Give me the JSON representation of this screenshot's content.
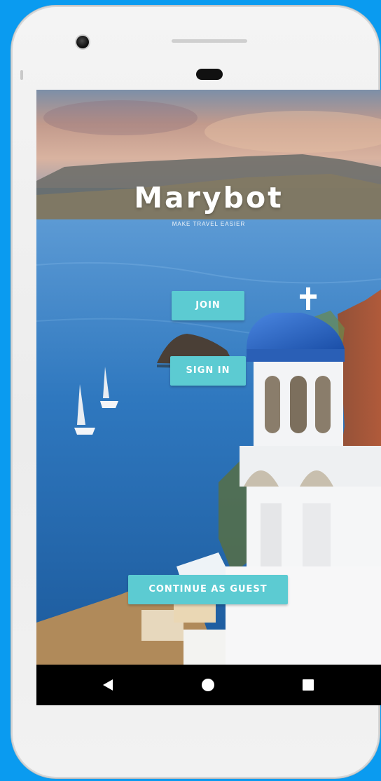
{
  "app": {
    "name": "Marybot",
    "tagline": "MAKE TRAVEL EASIER"
  },
  "actions": {
    "join_label": "JOIN",
    "signin_label": "SIGN IN",
    "guest_label": "CONTINUE AS GUEST"
  },
  "navigation": {
    "back_icon": "back-triangle-icon",
    "home_icon": "home-circle-icon",
    "recents_icon": "recents-square-icon"
  },
  "colors": {
    "background": "#0a9bf0",
    "button": "#5ccbd2",
    "button_text": "#ffffff",
    "nav_bar": "#000000"
  }
}
